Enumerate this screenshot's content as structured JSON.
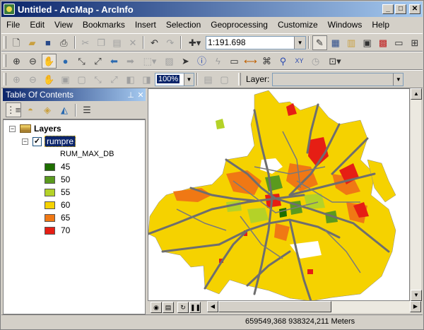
{
  "window": {
    "title": "Untitled - ArcMap - ArcInfo"
  },
  "menu": [
    "File",
    "Edit",
    "View",
    "Bookmarks",
    "Insert",
    "Selection",
    "Geoprocessing",
    "Customize",
    "Windows",
    "Help"
  ],
  "standard_toolbar": {
    "scale_value": "1:191.698"
  },
  "layout_toolbar": {
    "zoom_value": "100%"
  },
  "georef_toolbar": {
    "layer_label": "Layer:",
    "layer_value": ""
  },
  "toc": {
    "title": "Table Of Contents",
    "root_label": "Layers",
    "layer_name": "rumpre",
    "field_name": "RUM_MAX_DB",
    "legend": [
      {
        "label": "45",
        "color": "#1e6e00"
      },
      {
        "label": "50",
        "color": "#5a9a1e"
      },
      {
        "label": "55",
        "color": "#b4d228"
      },
      {
        "label": "60",
        "color": "#f5d200"
      },
      {
        "label": "65",
        "color": "#f07814"
      },
      {
        "label": "70",
        "color": "#e61e14"
      }
    ]
  },
  "status": {
    "coordinates": "659549,368  938324,211 Meters"
  },
  "colors": {
    "title_dark": "#0a246a",
    "title_light": "#a6caf0",
    "road": "#6e6e6e",
    "base_zone": "#f5d200"
  }
}
